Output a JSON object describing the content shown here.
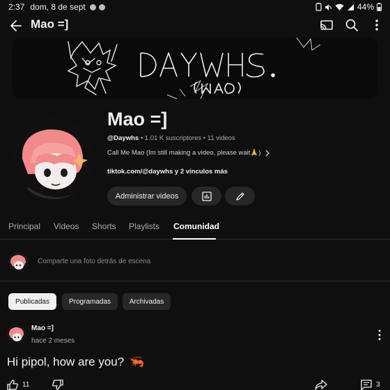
{
  "status_bar": {
    "time": "2:37",
    "date": "dom, 8 de sept",
    "battery": "44%"
  },
  "app_bar": {
    "title": "Mao =]",
    "icons": [
      "back-arrow-icon",
      "cast-icon",
      "search-icon",
      "more-vert-icon"
    ]
  },
  "banner": {
    "title_art": "DAYWHS.",
    "subtitle_art": "(MAO)"
  },
  "channel": {
    "name": "Mao =]",
    "handle": "@Daywhs",
    "subscribers": "1.01 K suscriptores",
    "videos": "11 videos",
    "separator": "•",
    "description": "Call Me Mao (Im still making a video, please wait🙏)",
    "links": "tiktok.com/@daywhs y 2 vínculos más",
    "manage_label": "Administrar videos"
  },
  "tabs": [
    {
      "label": "Principal",
      "active": false
    },
    {
      "label": "Videos",
      "active": false
    },
    {
      "label": "Shorts",
      "active": false
    },
    {
      "label": "Playlists",
      "active": false
    },
    {
      "label": "Comunidad",
      "active": true
    }
  ],
  "share_prompt": {
    "placeholder": "Comparte una foto detrás de escena"
  },
  "chips": [
    {
      "label": "Publicadas",
      "active": true
    },
    {
      "label": "Programadas",
      "active": false
    },
    {
      "label": "Archivadas",
      "active": false
    }
  ],
  "post": {
    "author": "Mao =]",
    "time": "hace 2 meses",
    "text": "Hi pipol, how are you?",
    "emoji": "🦐",
    "likes": "11",
    "comments": "3"
  },
  "colors": {
    "background": "#0f0f0f",
    "chip_bg": "#272727",
    "text_primary": "#f1f1f1",
    "text_secondary": "#aaaaaa"
  }
}
